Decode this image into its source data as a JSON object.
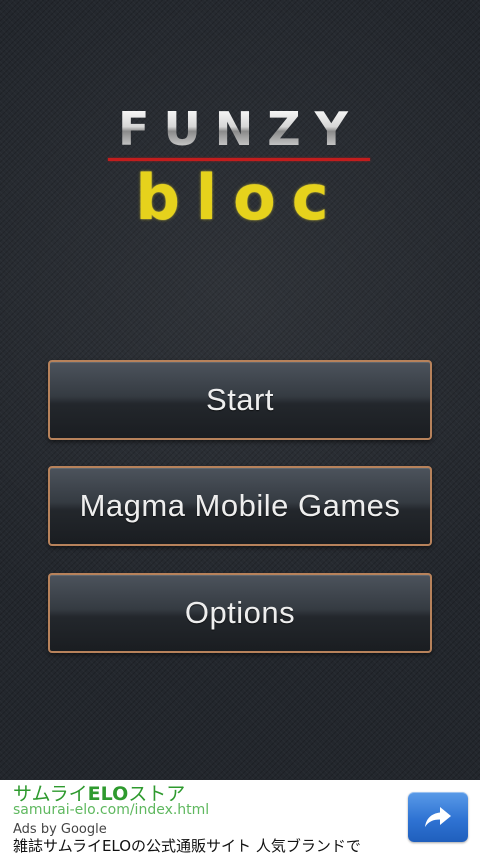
{
  "logo": {
    "line1": "FUNZY",
    "line2": "bloc"
  },
  "menu": {
    "start_label": "Start",
    "magma_label": "Magma Mobile Games",
    "options_label": "Options"
  },
  "ad": {
    "title_prefix": "サムライ",
    "title_bold": "ELO",
    "title_suffix": "ストア",
    "url": "samurai-elo.com/index.html",
    "provider": "Ads by Google",
    "description": "雑誌サムライELOの公式通販サイト 人気ブランドで",
    "go_icon": "share-arrow-icon"
  },
  "colors": {
    "button_border": "#b7825b",
    "logo_red_line": "#c21d1d",
    "logo_yellow": "#e6d21c",
    "ad_title_green": "#2e9a2e",
    "ad_button_blue": "#2f73d3"
  }
}
